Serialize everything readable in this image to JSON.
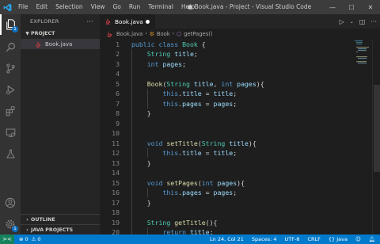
{
  "window": {
    "title": "● Book.java - Project - Visual Studio Code",
    "controls": {
      "minimize": "—",
      "maximize": "☐",
      "close": "✕"
    }
  },
  "menu": [
    "File",
    "Edit",
    "Selection",
    "View",
    "Go",
    "Run",
    "Terminal",
    "Help"
  ],
  "activity": {
    "explorer_badge": "1",
    "accounts_badge": "1"
  },
  "sidebar": {
    "title": "EXPLORER",
    "more": "···",
    "project_section": "PROJECT",
    "file": "Book.java",
    "outline": "OUTLINE",
    "java_projects": "JAVA PROJECTS"
  },
  "tab": {
    "label": "Book.java"
  },
  "breadcrumb": {
    "file": "Book.java",
    "class": "Book",
    "method": "getPages()"
  },
  "editor": {
    "line_numbers": [
      "1",
      "2",
      "3",
      "4",
      "5",
      "6",
      "7",
      "8",
      "9",
      "10",
      "11",
      "12",
      "13",
      "14",
      "15",
      "16",
      "17",
      "18",
      "19",
      "20"
    ],
    "lines": [
      [
        [
          "kw",
          "public"
        ],
        [
          "pl",
          " "
        ],
        [
          "kw",
          "class"
        ],
        [
          "pl",
          " "
        ],
        [
          "ty",
          "Book"
        ],
        [
          "pl",
          " {"
        ]
      ],
      [
        [
          "pl",
          "    "
        ],
        [
          "ty",
          "String"
        ],
        [
          "pl",
          " "
        ],
        [
          "vr",
          "title"
        ],
        [
          "pl",
          ";"
        ]
      ],
      [
        [
          "pl",
          "    "
        ],
        [
          "kw",
          "int"
        ],
        [
          "pl",
          " "
        ],
        [
          "vr",
          "pages"
        ],
        [
          "pl",
          ";"
        ]
      ],
      [],
      [
        [
          "pl",
          "    "
        ],
        [
          "fn",
          "Book"
        ],
        [
          "pl",
          "("
        ],
        [
          "ty",
          "String"
        ],
        [
          "pl",
          " "
        ],
        [
          "vr",
          "title"
        ],
        [
          "pl",
          ", "
        ],
        [
          "kw",
          "int"
        ],
        [
          "pl",
          " "
        ],
        [
          "vr",
          "pages"
        ],
        [
          "pl",
          "){"
        ]
      ],
      [
        [
          "pl",
          "        "
        ],
        [
          "kw",
          "this"
        ],
        [
          "pl",
          "."
        ],
        [
          "vr",
          "title"
        ],
        [
          "pl",
          " = "
        ],
        [
          "vr",
          "title"
        ],
        [
          "pl",
          ";"
        ]
      ],
      [
        [
          "pl",
          "        "
        ],
        [
          "kw",
          "this"
        ],
        [
          "pl",
          "."
        ],
        [
          "vr",
          "pages"
        ],
        [
          "pl",
          " = "
        ],
        [
          "vr",
          "pages"
        ],
        [
          "pl",
          ";"
        ]
      ],
      [
        [
          "pl",
          "    }"
        ]
      ],
      [],
      [],
      [
        [
          "pl",
          "    "
        ],
        [
          "kw",
          "void"
        ],
        [
          "pl",
          " "
        ],
        [
          "fn",
          "setTitle"
        ],
        [
          "pl",
          "("
        ],
        [
          "ty",
          "String"
        ],
        [
          "pl",
          " "
        ],
        [
          "vr",
          "title"
        ],
        [
          "pl",
          "){"
        ]
      ],
      [
        [
          "pl",
          "        "
        ],
        [
          "kw",
          "this"
        ],
        [
          "pl",
          "."
        ],
        [
          "vr",
          "title"
        ],
        [
          "pl",
          " = "
        ],
        [
          "vr",
          "title"
        ],
        [
          "pl",
          ";"
        ]
      ],
      [
        [
          "pl",
          "    }"
        ]
      ],
      [],
      [
        [
          "pl",
          "    "
        ],
        [
          "kw",
          "void"
        ],
        [
          "pl",
          " "
        ],
        [
          "fn",
          "setPages"
        ],
        [
          "pl",
          "("
        ],
        [
          "kw",
          "int"
        ],
        [
          "pl",
          " "
        ],
        [
          "vr",
          "pages"
        ],
        [
          "pl",
          "){"
        ]
      ],
      [
        [
          "pl",
          "        "
        ],
        [
          "kw",
          "this"
        ],
        [
          "pl",
          "."
        ],
        [
          "vr",
          "pages"
        ],
        [
          "pl",
          " = "
        ],
        [
          "vr",
          "pages"
        ],
        [
          "pl",
          ";"
        ]
      ],
      [
        [
          "pl",
          "    }"
        ]
      ],
      [],
      [
        [
          "pl",
          "    "
        ],
        [
          "ty",
          "String"
        ],
        [
          "pl",
          " "
        ],
        [
          "fn",
          "getTitle"
        ],
        [
          "pl",
          "(){"
        ]
      ],
      [
        [
          "pl",
          "        "
        ],
        [
          "kw",
          "return"
        ],
        [
          "pl",
          " "
        ],
        [
          "vr",
          "title"
        ],
        [
          "pl",
          ";"
        ]
      ]
    ]
  },
  "status": {
    "remote": "><",
    "errors": "0",
    "warnings": "0",
    "position": "Ln 24, Col 21",
    "spaces": "Spaces: 4",
    "encoding": "UTF-8",
    "eol": "CRLF",
    "language": "Java"
  },
  "colors": {
    "accent": "#007acc",
    "keyword": "#569cd6",
    "type": "#4ec9b0",
    "function": "#dcdcaa",
    "variable": "#9cdcfe",
    "java_icon": "#cc3e44"
  }
}
